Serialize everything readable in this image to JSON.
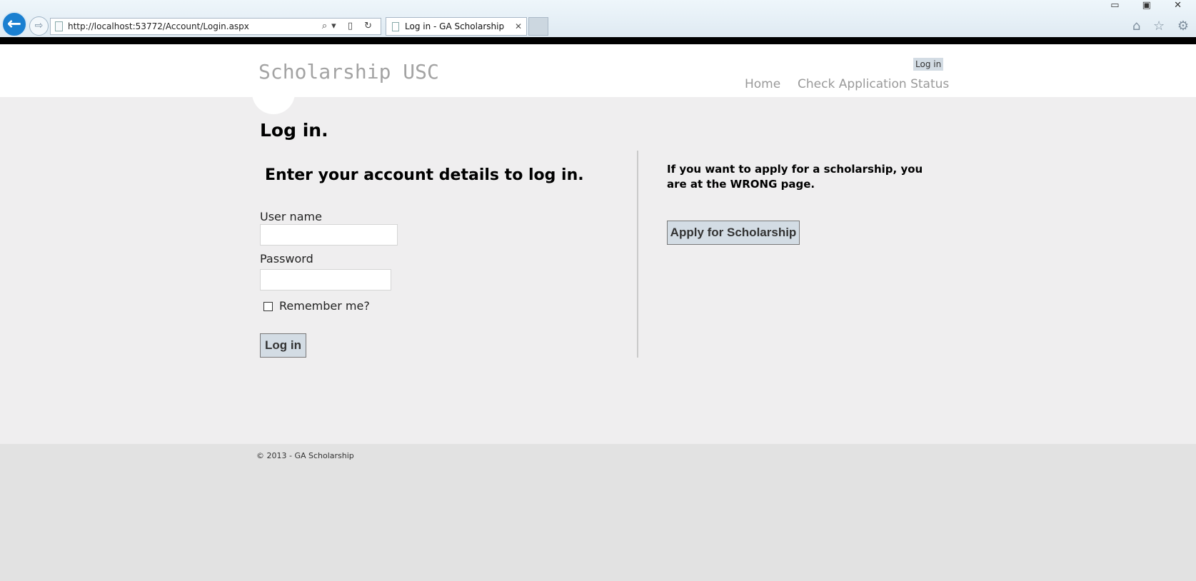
{
  "browser": {
    "url": "http://localhost:53772/Account/Login.aspx",
    "tab_title": "Log in - GA Scholarship",
    "back_icon": "arrow-left-icon",
    "forward_icon": "arrow-right-icon",
    "win_buttons": "▭ ▣ ✕",
    "right_icons": "⌂ ☆ ⚙",
    "address_icons": "⌕▾ ▯ ↻",
    "tab_close": "✕"
  },
  "header": {
    "site_title": "Scholarship USC",
    "login_link": "Log in",
    "nav": {
      "home": "Home",
      "status": "Check Application Status"
    }
  },
  "main": {
    "title": "Log in.",
    "subtitle": "Enter your account details to log in.",
    "username_label": "User name",
    "username_value": "",
    "password_label": "Password",
    "password_value": "",
    "remember_label": "Remember me?",
    "login_button": "Log in",
    "right_text": "If you want to apply for a scholarship, you are at the WRONG page.",
    "apply_button": "Apply for Scholarship"
  },
  "footer": {
    "copyright": "© 2013 - GA Scholarship"
  }
}
